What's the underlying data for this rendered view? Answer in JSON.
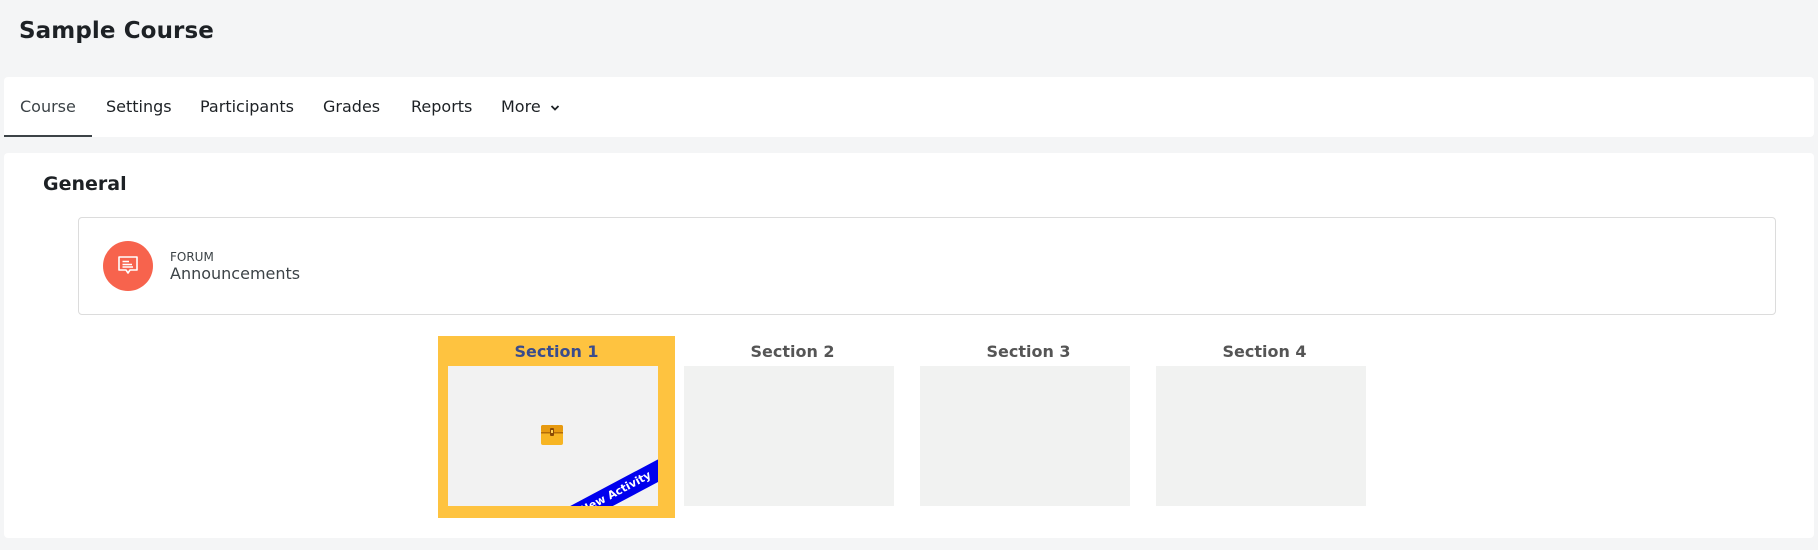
{
  "page": {
    "title": "Sample Course"
  },
  "nav": {
    "tabs": [
      {
        "label": "Course",
        "active": true
      },
      {
        "label": "Settings"
      },
      {
        "label": "Participants"
      },
      {
        "label": "Grades"
      },
      {
        "label": "Reports"
      },
      {
        "label": "More"
      }
    ],
    "more_icon": "chevron-down-icon"
  },
  "general": {
    "title": "General",
    "activity": {
      "type": "FORUM",
      "name": "Announcements",
      "icon": "forum-icon",
      "icon_color": "#f7634d"
    }
  },
  "sections": [
    {
      "label": "Section 1",
      "active": true,
      "icon": "treasure-chest-icon",
      "ribbon": "New Activity"
    },
    {
      "label": "Section 2"
    },
    {
      "label": "Section 3"
    },
    {
      "label": "Section 4"
    }
  ],
  "colors": {
    "accent": "#fec340",
    "ribbon": "#0000ee",
    "active_label": "#3a4c8c"
  }
}
